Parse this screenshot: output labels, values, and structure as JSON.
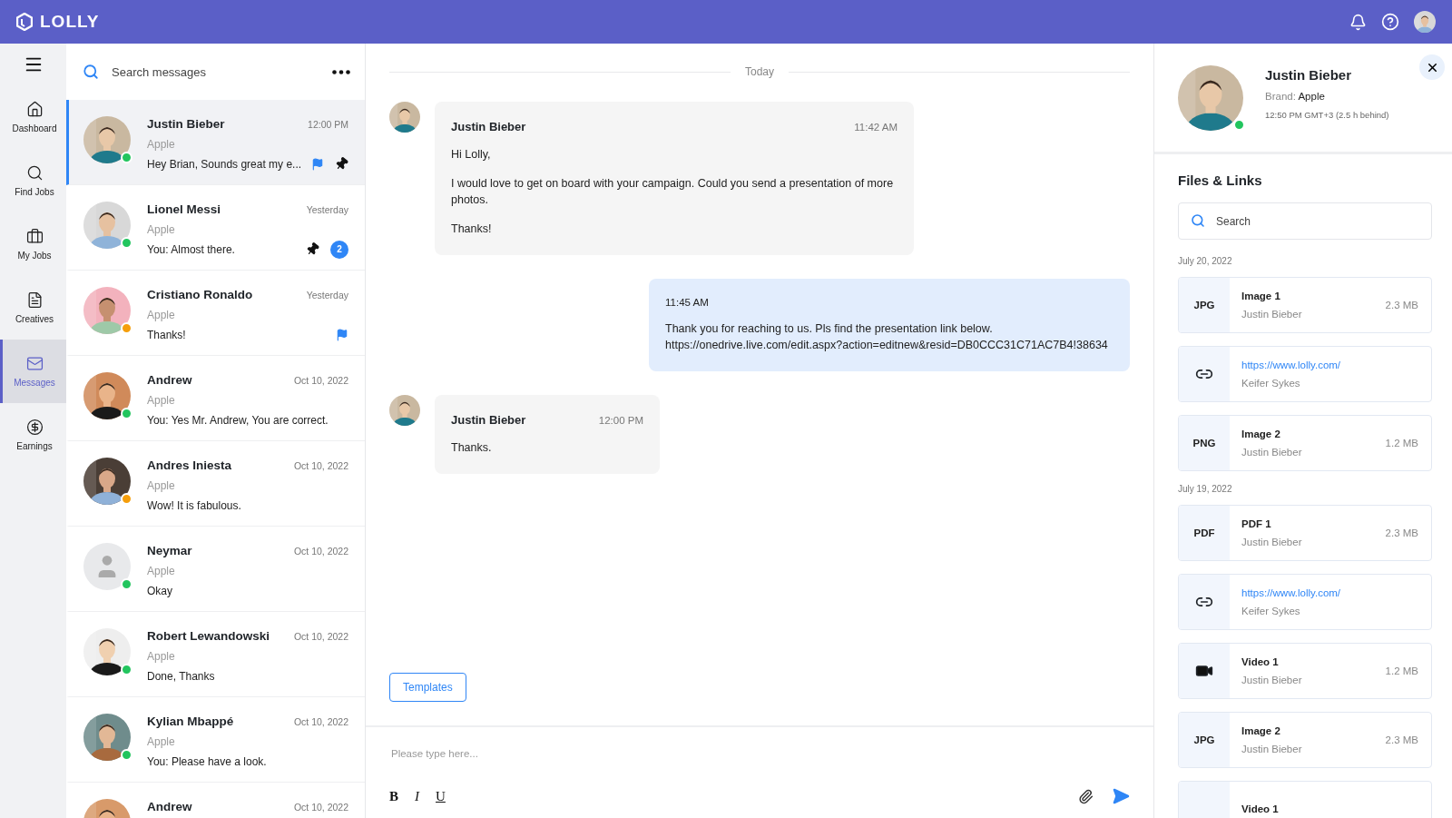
{
  "top_bar": {
    "logo": "LOLLY"
  },
  "nav": [
    {
      "label": "Dashboard",
      "kind": "home",
      "selected": false
    },
    {
      "label": "Find Jobs",
      "kind": "search",
      "selected": false
    },
    {
      "label": "My Jobs",
      "kind": "briefcase",
      "selected": false
    },
    {
      "label": "Creatives",
      "kind": "document",
      "selected": false
    },
    {
      "label": "Messages",
      "kind": "mail",
      "selected": true
    },
    {
      "label": "Earnings",
      "kind": "coin",
      "selected": false
    }
  ],
  "conversation_search": {
    "placeholder": "Search messages"
  },
  "conversations": [
    {
      "name": "Justin Bieber",
      "brand": "Apple",
      "time": "12:00 PM",
      "preview": "Hey Brian, Sounds great my e...",
      "color": "#22c55e",
      "flagged": true,
      "pinned": true,
      "selected": true
    },
    {
      "name": "Lionel Messi",
      "brand": "Apple",
      "time": "Yesterday",
      "preview": "You: Almost there.",
      "color": "#22c55e",
      "flagged": false,
      "pinned": true,
      "unread": "2",
      "selected": false
    },
    {
      "name": "Cristiano Ronaldo",
      "brand": "Apple",
      "time": "Yesterday",
      "preview": "Thanks!",
      "color": "#f59e0b",
      "flagged": true,
      "pinned": false,
      "selected": false
    },
    {
      "name": "Andrew",
      "brand": "Apple",
      "time": "Oct 10, 2022",
      "preview": "You: Yes Mr. Andrew, You are correct.",
      "color": "#22c55e",
      "flagged": false,
      "pinned": false,
      "selected": false
    },
    {
      "name": "Andres Iniesta",
      "brand": "Apple",
      "time": "Oct 10, 2022",
      "preview": "Wow! It is fabulous.",
      "color": "#f59e0b",
      "flagged": false,
      "pinned": false,
      "selected": false
    },
    {
      "name": "Neymar",
      "brand": "Apple",
      "time": "Oct 10, 2022",
      "preview": "Okay",
      "color": "#22c55e",
      "kind": "placeholder",
      "flagged": false,
      "pinned": false,
      "selected": false
    },
    {
      "name": "Robert Lewandowski",
      "brand": "Apple",
      "time": "Oct 10, 2022",
      "preview": "Done, Thanks",
      "color": "#22c55e",
      "flagged": false,
      "pinned": false,
      "selected": false
    },
    {
      "name": "Kylian Mbappé",
      "brand": "Apple",
      "time": "Oct 10, 2022",
      "preview": "You: Please have a look.",
      "color": "#22c55e",
      "flagged": false,
      "pinned": false,
      "selected": false
    },
    {
      "name": "Andrew",
      "time": "Oct 10, 2022",
      "selected": false
    }
  ],
  "chat": {
    "day": "Today",
    "messages": [
      {
        "kind": "incoming",
        "sender": "Justin Bieber",
        "time": "11:42 AM",
        "paragraphs": [
          "Hi Lolly,",
          "I would love to get on board with your campaign. Could you send a presentation of more photos.",
          "Thanks!"
        ]
      },
      {
        "kind": "outgoing",
        "time": "11:45 AM",
        "paragraphs": [
          "Thank you for reaching to us. Pls find the presentation link below.",
          "https://onedrive.live.com/edit.aspx?action=editnew&resid=DB0CCC31C71AC7B4!38634"
        ]
      },
      {
        "kind": "incoming",
        "sender": "Justin Bieber",
        "time": "12:00 PM",
        "paragraphs": [
          "Thanks."
        ]
      }
    ],
    "templates_button": "Templates",
    "composer": {
      "placeholder": "Please type here...",
      "format_buttons": [
        "B",
        "I",
        "U"
      ]
    }
  },
  "profile": {
    "name": "Justin Bieber",
    "brand_label": "Brand:",
    "brand": "Apple",
    "local_time": "12:50 PM GMT+3 (2.5 h behind)",
    "color": "#22c55e"
  },
  "files_links": {
    "title": "Files & Links",
    "search_placeholder": "Search",
    "groups": [
      {
        "date": "July 20, 2022",
        "items": [
          {
            "kind": "file",
            "type": "JPG",
            "title": "Image 1",
            "owner": "Justin Bieber",
            "size": "2.3 MB"
          },
          {
            "kind": "link",
            "title": "https://www.lolly.com/",
            "owner": "Keifer Sykes"
          },
          {
            "kind": "file",
            "type": "PNG",
            "title": "Image 2",
            "owner": "Justin Bieber",
            "size": "1.2 MB"
          }
        ]
      },
      {
        "date": "July 19, 2022",
        "items": [
          {
            "kind": "file",
            "type": "PDF",
            "title": "PDF 1",
            "owner": "Justin Bieber",
            "size": "2.3 MB"
          },
          {
            "kind": "link",
            "title": "https://www.lolly.com/",
            "owner": "Keifer Sykes"
          },
          {
            "kind": "video",
            "title": "Video 1",
            "owner": "Justin Bieber",
            "size": "1.2 MB"
          },
          {
            "kind": "file",
            "type": "JPG",
            "title": "Image 2",
            "owner": "Justin Bieber",
            "size": "2.3 MB"
          },
          {
            "kind": "video_cut",
            "title": "Video 1"
          }
        ]
      }
    ]
  }
}
